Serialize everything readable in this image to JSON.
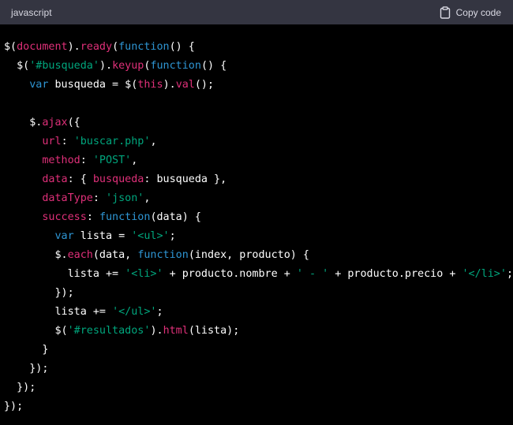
{
  "header": {
    "language": "javascript",
    "copy_label": "Copy code",
    "copy_icon": "clipboard-icon"
  },
  "colors": {
    "header_bg": "#343541",
    "code_bg": "#000000",
    "plain": "#ffffff",
    "keyword": "#2e95d3",
    "function": "#df3079",
    "string": "#00a67d"
  },
  "code": {
    "lines": [
      [
        [
          "pl",
          "$("
        ],
        [
          "fn",
          "document"
        ],
        [
          "pl",
          ")."
        ],
        [
          "fn",
          "ready"
        ],
        [
          "pl",
          "("
        ],
        [
          "kw",
          "function"
        ],
        [
          "pl",
          "() {"
        ]
      ],
      [
        [
          "pl",
          "  $("
        ],
        [
          "str",
          "'#busqueda'"
        ],
        [
          "pl",
          ")."
        ],
        [
          "fn",
          "keyup"
        ],
        [
          "pl",
          "("
        ],
        [
          "kw",
          "function"
        ],
        [
          "pl",
          "() {"
        ]
      ],
      [
        [
          "pl",
          "    "
        ],
        [
          "kw",
          "var"
        ],
        [
          "pl",
          " busqueda = $("
        ],
        [
          "fn",
          "this"
        ],
        [
          "pl",
          ")."
        ],
        [
          "fn",
          "val"
        ],
        [
          "pl",
          "();"
        ]
      ],
      [
        [
          "pl",
          ""
        ]
      ],
      [
        [
          "pl",
          "    $."
        ],
        [
          "fn",
          "ajax"
        ],
        [
          "pl",
          "({"
        ]
      ],
      [
        [
          "pl",
          "      "
        ],
        [
          "fn",
          "url"
        ],
        [
          "pl",
          ": "
        ],
        [
          "str",
          "'buscar.php'"
        ],
        [
          "pl",
          ","
        ]
      ],
      [
        [
          "pl",
          "      "
        ],
        [
          "fn",
          "method"
        ],
        [
          "pl",
          ": "
        ],
        [
          "str",
          "'POST'"
        ],
        [
          "pl",
          ","
        ]
      ],
      [
        [
          "pl",
          "      "
        ],
        [
          "fn",
          "data"
        ],
        [
          "pl",
          ": { "
        ],
        [
          "fn",
          "busqueda"
        ],
        [
          "pl",
          ": busqueda },"
        ]
      ],
      [
        [
          "pl",
          "      "
        ],
        [
          "fn",
          "dataType"
        ],
        [
          "pl",
          ": "
        ],
        [
          "str",
          "'json'"
        ],
        [
          "pl",
          ","
        ]
      ],
      [
        [
          "pl",
          "      "
        ],
        [
          "fn",
          "success"
        ],
        [
          "pl",
          ": "
        ],
        [
          "kw",
          "function"
        ],
        [
          "pl",
          "(data) {"
        ]
      ],
      [
        [
          "pl",
          "        "
        ],
        [
          "kw",
          "var"
        ],
        [
          "pl",
          " lista = "
        ],
        [
          "str",
          "'<ul>'"
        ],
        [
          "pl",
          ";"
        ]
      ],
      [
        [
          "pl",
          "        $."
        ],
        [
          "fn",
          "each"
        ],
        [
          "pl",
          "(data, "
        ],
        [
          "kw",
          "function"
        ],
        [
          "pl",
          "(index, producto) {"
        ]
      ],
      [
        [
          "pl",
          "          lista += "
        ],
        [
          "str",
          "'<li>'"
        ],
        [
          "pl",
          " + producto.nombre + "
        ],
        [
          "str",
          "' - '"
        ],
        [
          "pl",
          " + producto.precio + "
        ],
        [
          "str",
          "'</li>'"
        ],
        [
          "pl",
          ";"
        ]
      ],
      [
        [
          "pl",
          "        });"
        ]
      ],
      [
        [
          "pl",
          "        lista += "
        ],
        [
          "str",
          "'</ul>'"
        ],
        [
          "pl",
          ";"
        ]
      ],
      [
        [
          "pl",
          "        $("
        ],
        [
          "str",
          "'#resultados'"
        ],
        [
          "pl",
          ")."
        ],
        [
          "fn",
          "html"
        ],
        [
          "pl",
          "(lista);"
        ]
      ],
      [
        [
          "pl",
          "      }"
        ]
      ],
      [
        [
          "pl",
          "    });"
        ]
      ],
      [
        [
          "pl",
          "  });"
        ]
      ],
      [
        [
          "pl",
          "});"
        ]
      ]
    ]
  }
}
